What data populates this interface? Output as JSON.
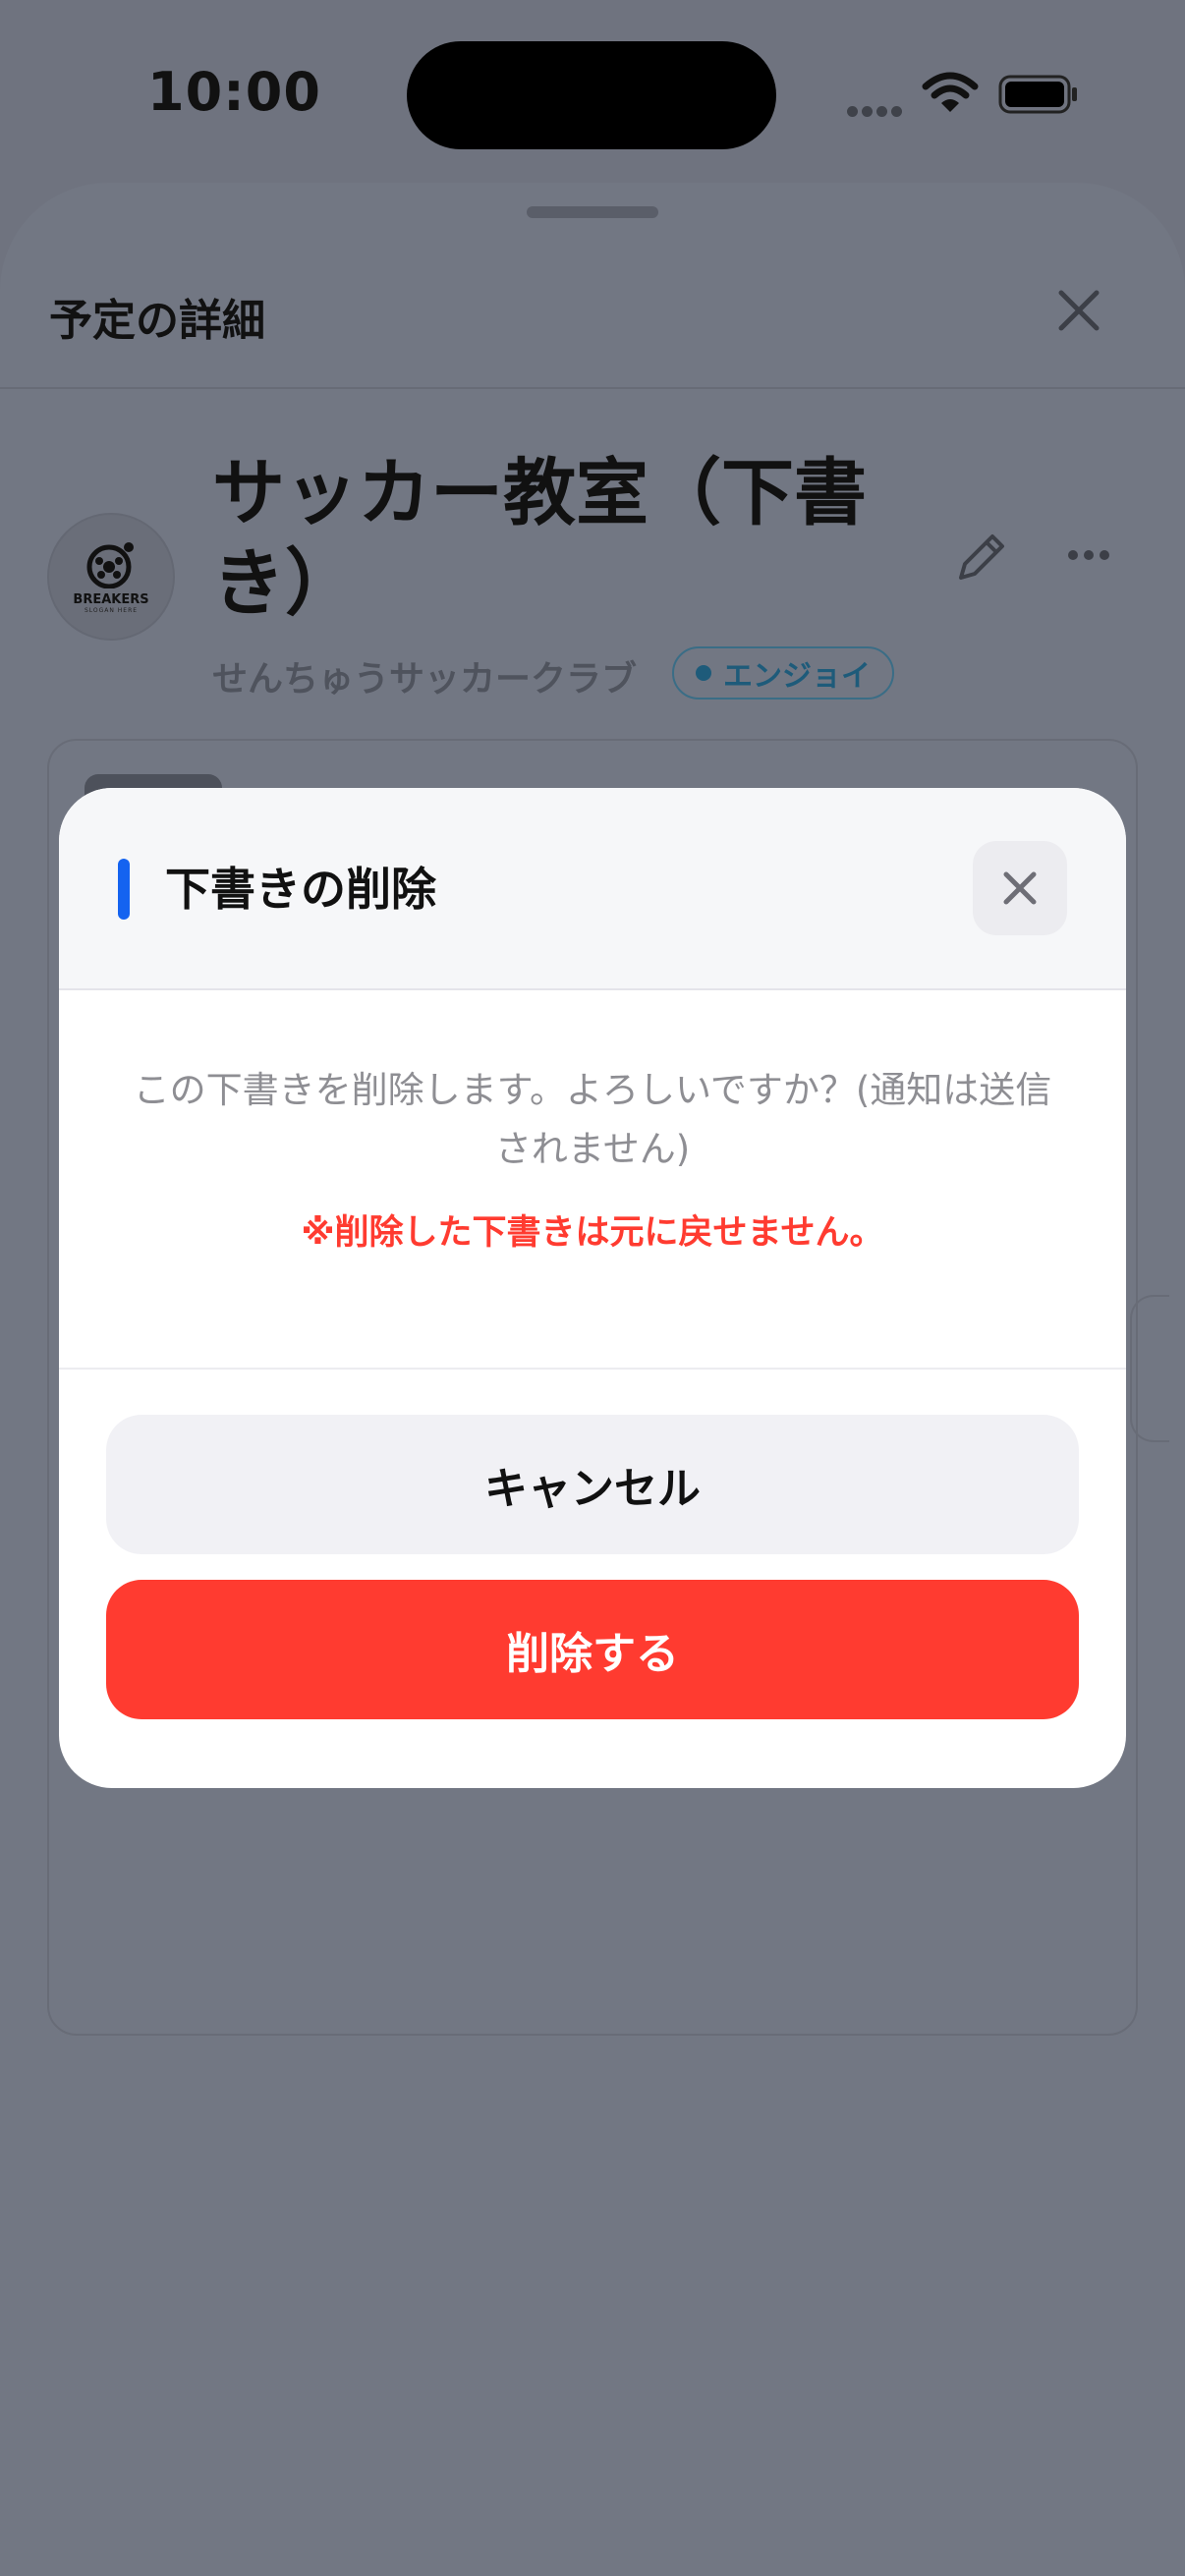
{
  "status_bar": {
    "time": "10:00"
  },
  "sheet": {
    "title": "予定の詳細",
    "close_icon": "close-icon",
    "event_title": "サッカー教室（下書き）",
    "club_name": "せんちゅうサッカークラブ",
    "tag_label": "エンジョイ",
    "logo": {
      "name": "BREAKERS",
      "sub": "SLOGAN HERE"
    }
  },
  "modal": {
    "title": "下書きの削除",
    "message": "この下書きを削除します。よろしいですか？(通知は送信されません)",
    "warning": "※削除した下書きは元に戻せません。",
    "cancel_label": "キャンセル",
    "delete_label": "削除する"
  },
  "colors": {
    "accent": "#1463f0",
    "danger": "#ff3b30",
    "overlay": "#6f737f",
    "tag": "#1e5b7a"
  },
  "icons": [
    "wifi-icon",
    "battery-icon",
    "close-icon",
    "pencil-icon",
    "more-icon"
  ]
}
